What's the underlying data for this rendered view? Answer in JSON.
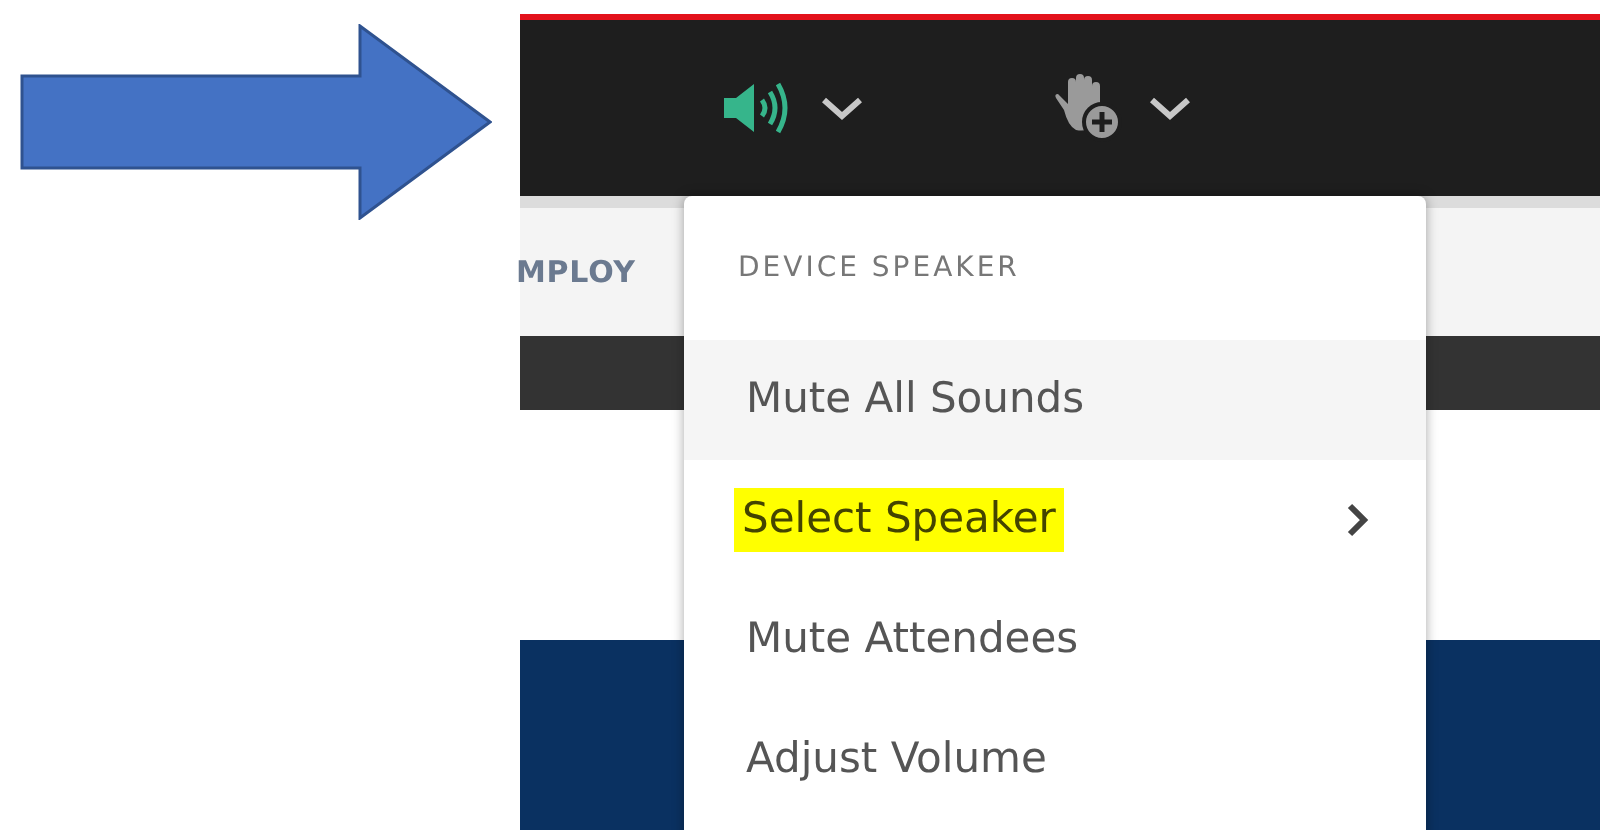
{
  "toolbar": {
    "audio_menu_open": true
  },
  "nav": {
    "tab_text": "MPLOY"
  },
  "menu": {
    "header": "DEVICE SPEAKER",
    "items": [
      {
        "label": "Mute All Sounds",
        "hovered": true,
        "highlighted": false,
        "submenu": false
      },
      {
        "label": "Select Speaker",
        "hovered": false,
        "highlighted": true,
        "submenu": true
      },
      {
        "label": "Mute Attendees",
        "hovered": false,
        "highlighted": false,
        "submenu": false
      },
      {
        "label": "Adjust Volume",
        "hovered": false,
        "highlighted": false,
        "submenu": false
      }
    ]
  }
}
